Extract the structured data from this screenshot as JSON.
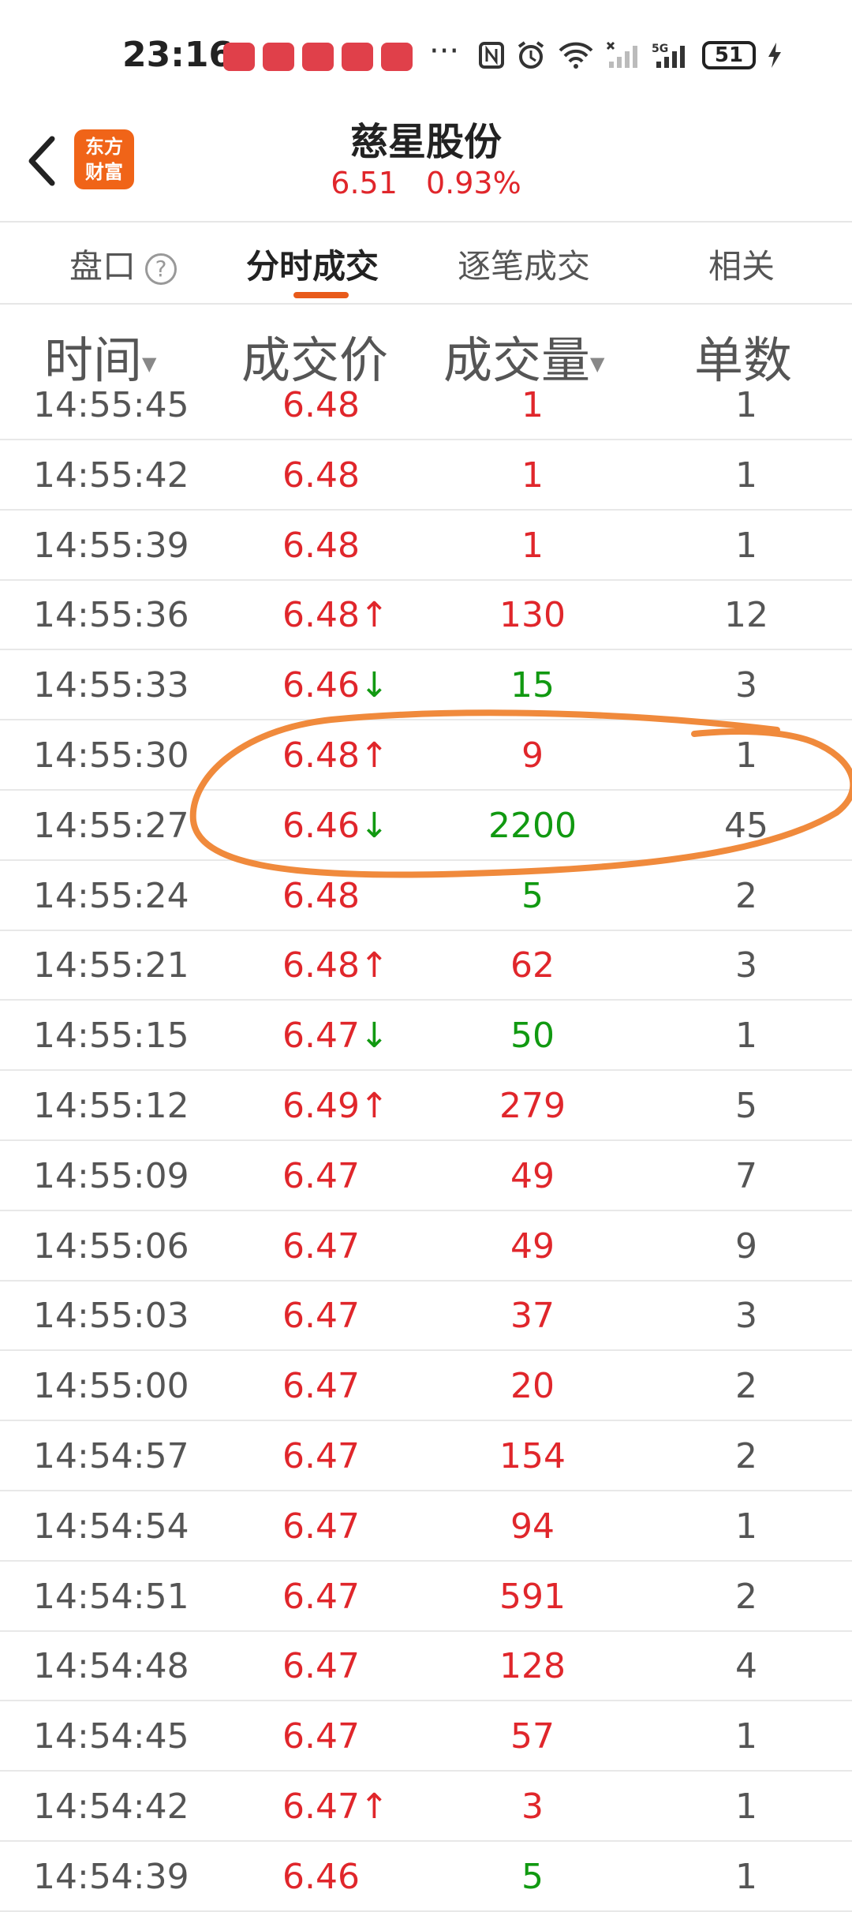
{
  "status_bar": {
    "time": "23:16",
    "dots": "···",
    "battery": "51"
  },
  "header": {
    "logo_line1": "东方",
    "logo_line2": "财富",
    "title": "慈星股份",
    "price": "6.51",
    "change": "0.93%"
  },
  "tabs": [
    {
      "label": "盘口",
      "active": false
    },
    {
      "label": "分时成交",
      "active": true
    },
    {
      "label": "逐笔成交",
      "active": false
    },
    {
      "label": "相关",
      "active": false
    }
  ],
  "columns": {
    "time": "时间",
    "price": "成交价",
    "volume": "成交量",
    "count": "单数"
  },
  "colors": {
    "up": "#e0262b",
    "down": "#119911",
    "accent": "#e85a1a",
    "annotation": "#f08a3c"
  },
  "rows": [
    {
      "time": "14:55:45",
      "price": "6.48",
      "arrow": "",
      "price_color": "red",
      "volume": "1",
      "vol_color": "red",
      "count": "1"
    },
    {
      "time": "14:55:42",
      "price": "6.48",
      "arrow": "",
      "price_color": "red",
      "volume": "1",
      "vol_color": "red",
      "count": "1"
    },
    {
      "time": "14:55:39",
      "price": "6.48",
      "arrow": "",
      "price_color": "red",
      "volume": "1",
      "vol_color": "red",
      "count": "1"
    },
    {
      "time": "14:55:36",
      "price": "6.48",
      "arrow": "↑",
      "price_color": "red",
      "volume": "130",
      "vol_color": "red",
      "count": "12"
    },
    {
      "time": "14:55:33",
      "price": "6.46",
      "arrow": "↓",
      "price_color": "red",
      "volume": "15",
      "vol_color": "green",
      "count": "3"
    },
    {
      "time": "14:55:30",
      "price": "6.48",
      "arrow": "↑",
      "price_color": "red",
      "volume": "9",
      "vol_color": "red",
      "count": "1"
    },
    {
      "time": "14:55:27",
      "price": "6.46",
      "arrow": "↓",
      "price_color": "red",
      "volume": "2200",
      "vol_color": "green",
      "count": "45"
    },
    {
      "time": "14:55:24",
      "price": "6.48",
      "arrow": "",
      "price_color": "red",
      "volume": "5",
      "vol_color": "green",
      "count": "2"
    },
    {
      "time": "14:55:21",
      "price": "6.48",
      "arrow": "↑",
      "price_color": "red",
      "volume": "62",
      "vol_color": "red",
      "count": "3"
    },
    {
      "time": "14:55:15",
      "price": "6.47",
      "arrow": "↓",
      "price_color": "red",
      "volume": "50",
      "vol_color": "green",
      "count": "1"
    },
    {
      "time": "14:55:12",
      "price": "6.49",
      "arrow": "↑",
      "price_color": "red",
      "volume": "279",
      "vol_color": "red",
      "count": "5"
    },
    {
      "time": "14:55:09",
      "price": "6.47",
      "arrow": "",
      "price_color": "red",
      "volume": "49",
      "vol_color": "red",
      "count": "7"
    },
    {
      "time": "14:55:06",
      "price": "6.47",
      "arrow": "",
      "price_color": "red",
      "volume": "49",
      "vol_color": "red",
      "count": "9"
    },
    {
      "time": "14:55:03",
      "price": "6.47",
      "arrow": "",
      "price_color": "red",
      "volume": "37",
      "vol_color": "red",
      "count": "3"
    },
    {
      "time": "14:55:00",
      "price": "6.47",
      "arrow": "",
      "price_color": "red",
      "volume": "20",
      "vol_color": "red",
      "count": "2"
    },
    {
      "time": "14:54:57",
      "price": "6.47",
      "arrow": "",
      "price_color": "red",
      "volume": "154",
      "vol_color": "red",
      "count": "2"
    },
    {
      "time": "14:54:54",
      "price": "6.47",
      "arrow": "",
      "price_color": "red",
      "volume": "94",
      "vol_color": "red",
      "count": "1"
    },
    {
      "time": "14:54:51",
      "price": "6.47",
      "arrow": "",
      "price_color": "red",
      "volume": "591",
      "vol_color": "red",
      "count": "2"
    },
    {
      "time": "14:54:48",
      "price": "6.47",
      "arrow": "",
      "price_color": "red",
      "volume": "128",
      "vol_color": "red",
      "count": "4"
    },
    {
      "time": "14:54:45",
      "price": "6.47",
      "arrow": "",
      "price_color": "red",
      "volume": "57",
      "vol_color": "red",
      "count": "1"
    },
    {
      "time": "14:54:42",
      "price": "6.47",
      "arrow": "↑",
      "price_color": "red",
      "volume": "3",
      "vol_color": "red",
      "count": "1"
    },
    {
      "time": "14:54:39",
      "price": "6.46",
      "arrow": "",
      "price_color": "red",
      "volume": "5",
      "vol_color": "green",
      "count": "1"
    }
  ]
}
